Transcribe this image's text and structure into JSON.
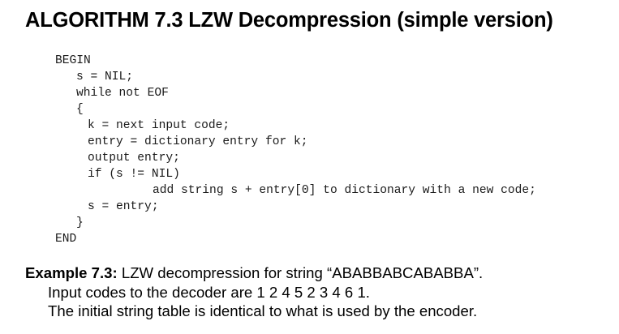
{
  "title": "ALGORITHM 7.3 LZW Decompression (simple version)",
  "code_lines": [
    "BEGIN",
    "s = NIL;",
    "while not EOF",
    "{",
    "k = next input code;",
    "entry = dictionary entry for k;",
    "output entry;",
    "if (s != NIL)",
    "add string s + entry[0] to dictionary with a new code;",
    "s = entry;",
    "}",
    "END"
  ],
  "example": {
    "label": "Example 7.3:",
    "text": " LZW decompression for string “ABABBABCABABBA”.",
    "line2": "Input codes to the decoder are 1 2 4 5 2 3 4 6 1.",
    "line3": "The initial string table is identical to what is used by the encoder."
  }
}
